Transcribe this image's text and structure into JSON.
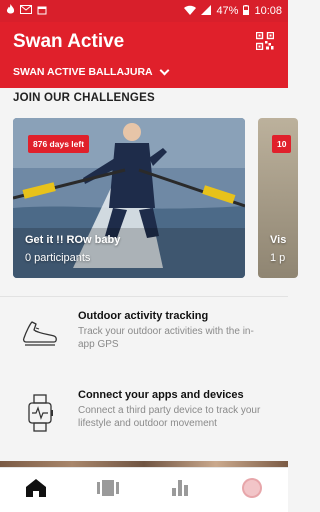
{
  "status_bar": {
    "battery_percent": "47%",
    "time": "10:08",
    "left_icons": [
      "fire-icon",
      "gmail-icon",
      "calendar-icon"
    ],
    "right_icons": [
      "wifi-icon",
      "signal-icon",
      "battery-icon"
    ]
  },
  "app_bar": {
    "title": "Swan Active",
    "club": "SWAN ACTIVE BALLAJURA",
    "qr_icon": "qr-code-icon",
    "background_color": "#e0202b"
  },
  "challenges": {
    "section_title": "JOIN OUR CHALLENGES",
    "cards": [
      {
        "badge": "876 days left",
        "title": "Get it !! ROw baby",
        "participants": "0 participants"
      },
      {
        "badge": "10",
        "title": "Vis",
        "participants": "1 p"
      }
    ]
  },
  "features": [
    {
      "icon": "shoe-icon",
      "title": "Outdoor activity tracking",
      "description": "Track your outdoor activities with the in-app GPS"
    },
    {
      "icon": "smartwatch-icon",
      "title": "Connect your apps and devices",
      "description": "Connect a third party device to track your lifestyle and outdoor movement"
    }
  ],
  "bottom_nav": {
    "items": [
      "home-icon",
      "cards-icon",
      "stats-icon",
      "profile-icon"
    ],
    "active": "home-icon",
    "accent_color": "#e0202b"
  }
}
